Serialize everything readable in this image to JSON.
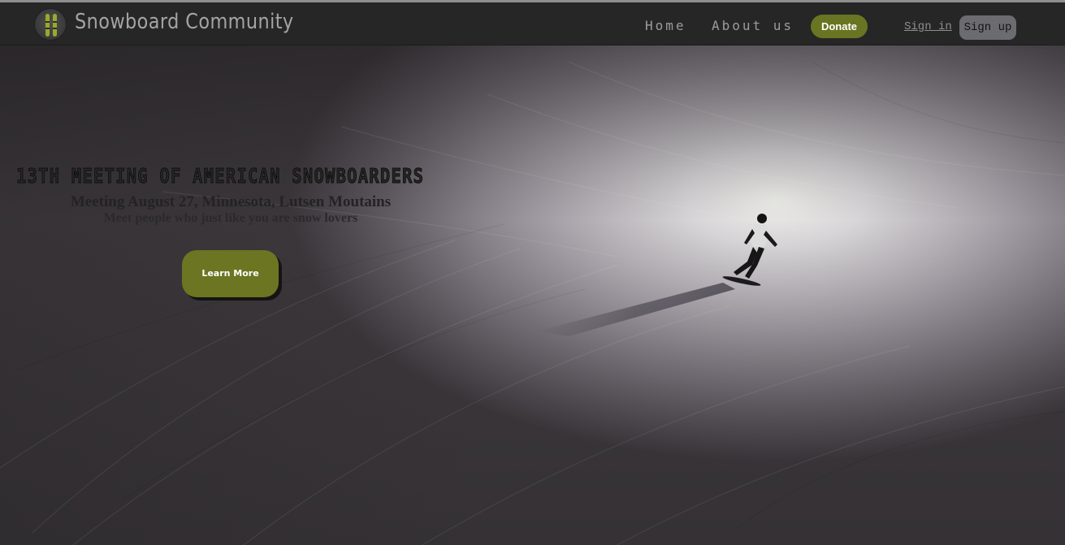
{
  "navbar": {
    "brand": "Snowboard Community",
    "links": [
      "Home",
      "About us"
    ],
    "donate_label": "Donate",
    "signin_label": "Sign in",
    "signup_label": "Sign up"
  },
  "icons": {
    "logo": "snowboard-logo-icon"
  },
  "hero": {
    "title": "13TH MEETING OF AMERICAN SNOWBOARDERS",
    "subtitle": "Meeting August 27, Minnesota, Lutsen Moutains",
    "tagline": "Meet people who just like you are snow lovers",
    "cta_label": "Learn More"
  },
  "colors": {
    "navbar_bg": "#262626",
    "accent_green": "#697522",
    "signup_bg": "#6c6b70",
    "snow": "#e4e2e6"
  }
}
